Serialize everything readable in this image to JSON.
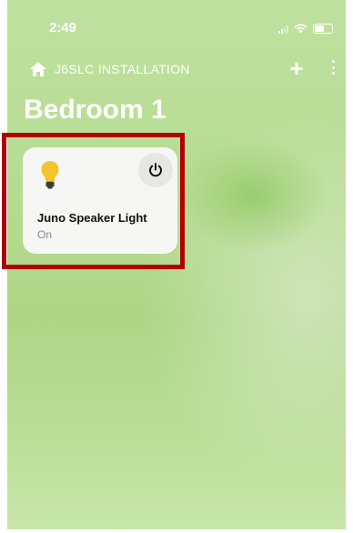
{
  "status_bar": {
    "time": "2:49"
  },
  "header": {
    "location": "J6SLC INSTALLATION",
    "add_label": "+"
  },
  "room": {
    "title": "Bedroom 1"
  },
  "device": {
    "name": "Juno Speaker Light",
    "status": "On",
    "icon": "light-bulb-icon"
  },
  "colors": {
    "highlight": "#b00000",
    "bulb": "#f4c430",
    "background": "#b6dc92"
  }
}
